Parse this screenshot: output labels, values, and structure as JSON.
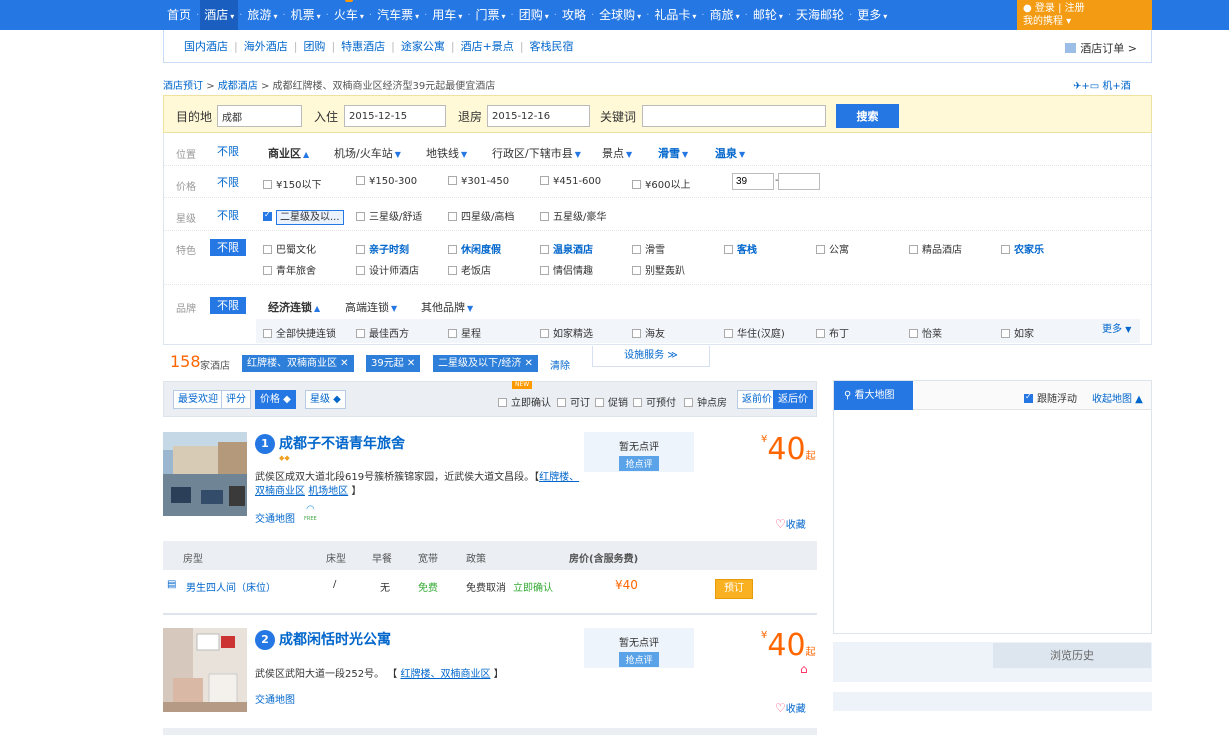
{
  "topnav": {
    "items": [
      {
        "label": "首页",
        "arrow": false,
        "active": false
      },
      {
        "label": "酒店",
        "arrow": true,
        "active": true
      },
      {
        "label": "旅游",
        "arrow": true,
        "active": false
      },
      {
        "label": "机票",
        "arrow": true,
        "active": false
      },
      {
        "label": "火车",
        "arrow": true,
        "active": false,
        "hot": true
      },
      {
        "label": "汽车票",
        "arrow": true,
        "active": false
      },
      {
        "label": "用车",
        "arrow": true,
        "active": false
      },
      {
        "label": "门票",
        "arrow": true,
        "active": false
      },
      {
        "label": "团购",
        "arrow": true,
        "active": false
      },
      {
        "label": "攻略",
        "arrow": false,
        "active": false
      },
      {
        "label": "全球购",
        "arrow": true,
        "active": false
      },
      {
        "label": "礼品卡",
        "arrow": true,
        "active": false
      },
      {
        "label": "商旅",
        "arrow": true,
        "active": false
      },
      {
        "label": "邮轮",
        "arrow": true,
        "active": false
      },
      {
        "label": "天海邮轮",
        "arrow": false,
        "active": false
      },
      {
        "label": "更多",
        "arrow": true,
        "active": false
      }
    ],
    "arrow_glyph": "▾",
    "login": "登录",
    "register": "注册",
    "my_trip": "我的携程 ▾"
  },
  "subnav": {
    "items": [
      "国内酒店",
      "海外酒店",
      "团购",
      "特惠酒店",
      "途家公寓",
      "酒店+景点",
      "客栈民宿"
    ],
    "new_tag": "NEW",
    "order": "酒店订单 >"
  },
  "breadcrumb": {
    "c1": "酒店预订",
    "c2": "成都酒店",
    "current": "成都红牌楼、双楠商业区经济型39元起最便宜酒店",
    "sep": ">"
  },
  "flight_link": "机+酒",
  "search": {
    "dest_label": "目的地",
    "dest_value": "成都",
    "checkin_label": "入住",
    "checkin_value": "2015-12-15",
    "checkout_label": "退房",
    "checkout_value": "2015-12-16",
    "keyword_label": "关键词",
    "keyword_value": "",
    "button": "搜索"
  },
  "filters": {
    "unlimited": "不限",
    "location": {
      "label": "位置",
      "options": [
        "商业区",
        "机场/火车站",
        "地铁线",
        "行政区/下辖市县",
        "景点",
        "滑雪",
        "温泉"
      ]
    },
    "price": {
      "label": "价格",
      "options": [
        "¥150以下",
        "¥150-300",
        "¥301-450",
        "¥451-600",
        "¥600以上"
      ],
      "min": "39",
      "max": "",
      "dash": "-"
    },
    "star": {
      "label": "星级",
      "options": [
        "二星级及以...",
        "三星级/舒适",
        "四星级/高档",
        "五星级/豪华"
      ]
    },
    "feature": {
      "label": "特色",
      "row1": [
        "巴蜀文化",
        "亲子时刻",
        "休闲度假",
        "温泉酒店",
        "滑雪",
        "客栈",
        "公寓",
        "精品酒店",
        "农家乐"
      ],
      "row2": [
        "青年旅舍",
        "设计师酒店",
        "老饭店",
        "情侣情趣",
        "别墅轰趴"
      ]
    },
    "brand": {
      "label": "品牌",
      "tabs": [
        "经济连锁",
        "高端连锁",
        "其他品牌"
      ],
      "options": [
        "全部快捷连锁",
        "最佳西方",
        "星程",
        "如家精选",
        "海友",
        "华住(汉庭)",
        "布丁",
        "怡莱",
        "如家"
      ],
      "more": "更多"
    }
  },
  "results": {
    "count": "158",
    "count_label": "家酒店",
    "chips": [
      "红牌楼、双楠商业区 ✕",
      "39元起 ✕",
      "二星级及以下/经济 ✕"
    ],
    "clear": "清除",
    "more_services": "设施服务 ≫"
  },
  "sort": {
    "buttons": [
      "最受欢迎",
      "评分",
      "价格 ◆",
      "星级 ◆"
    ],
    "checks": [
      "立即确认",
      "可订",
      "促销",
      "可预付",
      "钟点房"
    ],
    "new_tag": "NEW",
    "before_price": "返前价",
    "after_price": "返后价"
  },
  "hotels": [
    {
      "num": "1",
      "name": "成都子不语青年旅舍",
      "diamonds": "◆◆",
      "address": "武侯区成双大道北段619号簇桥簇锦家园，近武侯大道文昌段。",
      "block_open": "【",
      "block_area1": "红牌楼、双楠商业区",
      "block_area2": "机场地区",
      "block_close": "】",
      "map": "交通地图",
      "wifi": "FREE",
      "review": "暂无点评",
      "review_btn": "抢点评",
      "currency": "¥",
      "price": "40",
      "price_suffix": "起",
      "fav": "收藏",
      "heart": "♡"
    },
    {
      "num": "2",
      "name": "成都闲恬时光公寓",
      "address": "武侯区武阳大道一段252号。",
      "block_open": "【",
      "block_area1": "红牌楼、双楠商业区",
      "block_close": "】",
      "map": "交通地图",
      "review": "暂无点评",
      "review_btn": "抢点评",
      "currency": "¥",
      "price": "40",
      "price_suffix": "起",
      "fav": "收藏",
      "heart": "♡"
    }
  ],
  "room_table": {
    "headers": [
      "房型",
      "床型",
      "早餐",
      "宽带",
      "政策",
      "房价(含服务费)"
    ],
    "row": {
      "name": "男生四人间（床位）",
      "bed": "/",
      "breakfast": "无",
      "broadband": "免费",
      "policy": "免费取消",
      "confirm": "立即确认",
      "price": "¥40",
      "book": "预订"
    }
  },
  "map_panel": {
    "button": "看大地图",
    "follow": "跟随浮动",
    "collapse": "收起地图 ▲"
  },
  "history": "浏览历史",
  "colors": {
    "nav_blue": "#2577e3",
    "orange": "#f39b12",
    "price": "#ff6600"
  }
}
